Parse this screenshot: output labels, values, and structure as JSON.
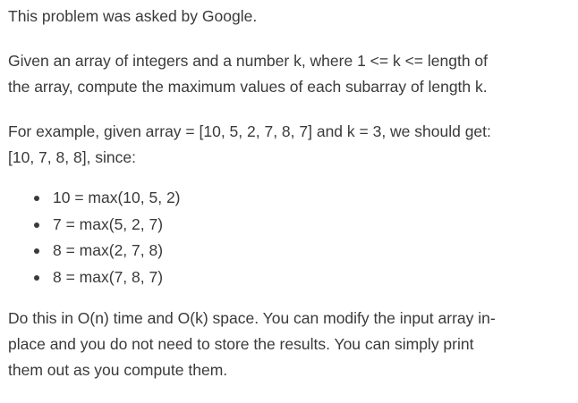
{
  "intro": "This problem was asked by Google.",
  "problem": {
    "line1": "Given an array of integers and a number k, where 1 <= k <= length of",
    "line2": "the array, compute the maximum values of each subarray of length k."
  },
  "example": {
    "line1": "For example, given array = [10, 5, 2, 7, 8, 7] and k = 3, we should get:",
    "line2": "[10, 7, 8, 8], since:"
  },
  "bullets": [
    "10 = max(10, 5, 2)",
    "7 = max(5, 2, 7)",
    "8 = max(2, 7, 8)",
    "8 = max(7, 8, 7)"
  ],
  "constraints": {
    "line1": "Do this in O(n) time and O(k) space. You can modify the input array in-",
    "line2": "place and you do not need to store the results. You can simply print",
    "line3": "them out as you compute them."
  }
}
